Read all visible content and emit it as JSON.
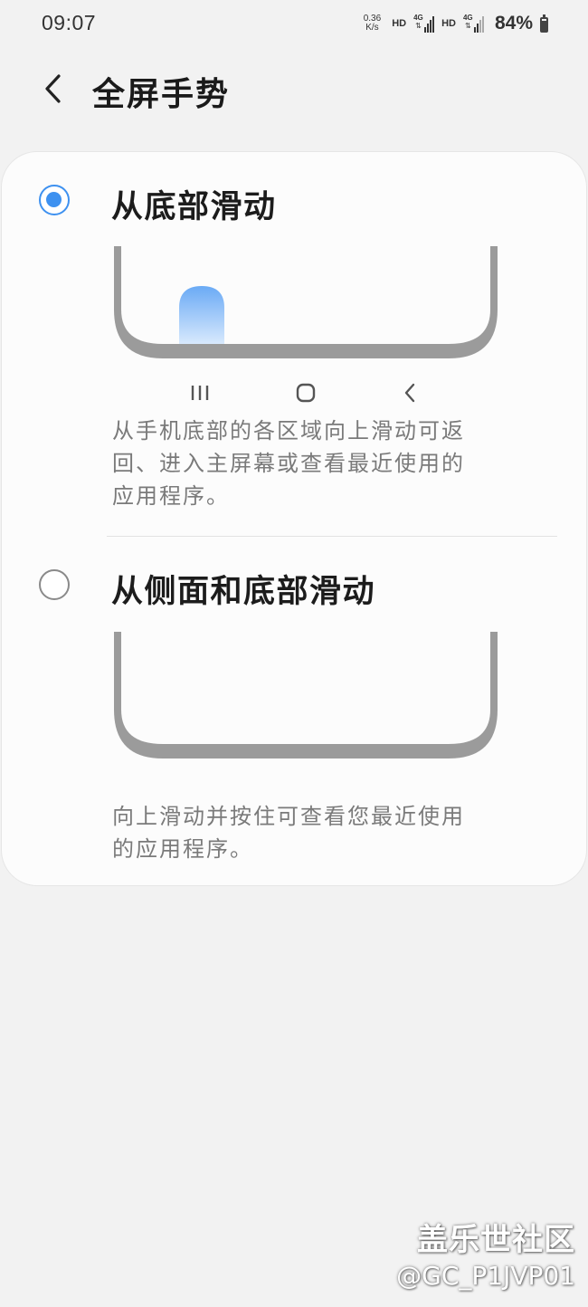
{
  "status_bar": {
    "time": "09:07",
    "net_speed_value": "0.36",
    "net_speed_unit": "K/s",
    "hd1": "HD",
    "hd2": "HD",
    "sim1_type": "4G",
    "sim2_type": "4G",
    "battery_percent": "84%",
    "battery_level": 0.84,
    "icons": [
      "network-speed-icon",
      "volte-hd-icon",
      "signal-icon",
      "volte-hd-icon",
      "signal-icon",
      "battery-icon"
    ]
  },
  "header": {
    "back_icon": "chevron-left-icon",
    "title": "全屏手势"
  },
  "options": [
    {
      "label": "从底部滑动",
      "selected": true,
      "description_lines": [
        "从手机底部的各区域向上滑动可返",
        "回、进入主屏幕或查看最近使用的",
        "应用程序。"
      ],
      "nav_hints": [
        "recents-icon",
        "home-icon",
        "back-icon"
      ]
    },
    {
      "label": "从侧面和底部滑动",
      "selected": false,
      "description_lines": [
        "向上滑动并按住可查看您最近使用",
        "的应用程序。"
      ]
    }
  ],
  "colors": {
    "accent": "#3e91f0",
    "background": "#f2f2f2",
    "card": "#fcfcfc",
    "phone_outline": "#9b9b9b",
    "swipe_indicator_top": "#6aaaf5",
    "swipe_indicator_bottom": "#d8e9fd",
    "description_text": "#7a7a7a"
  },
  "watermark": {
    "brand": "盖乐世社区",
    "user": "@GC_P1JVP01"
  }
}
